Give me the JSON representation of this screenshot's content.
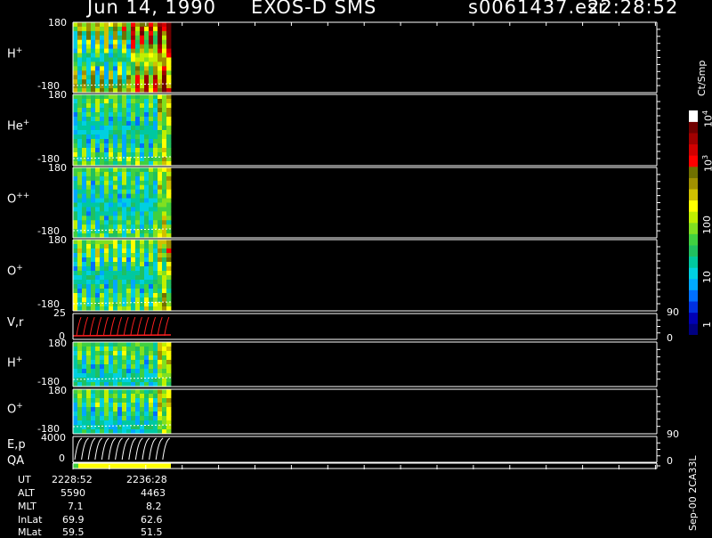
{
  "header": {
    "date": "Jun 14, 1990",
    "instrument": "EXOS-D SMS",
    "file": "s0061437.esr",
    "time": "22:28:52"
  },
  "panels": [
    {
      "id": "h-plus",
      "name": "H",
      "sup": "+",
      "ymax": "180",
      "ymin": "-180"
    },
    {
      "id": "he-plus",
      "name": "He",
      "sup": "+",
      "ymax": "180",
      "ymin": "-180"
    },
    {
      "id": "o-plusplus",
      "name": "O",
      "sup": "++",
      "ymax": "180",
      "ymin": "-180"
    },
    {
      "id": "o-plus",
      "name": "O",
      "sup": "+",
      "ymax": "180",
      "ymin": "-180"
    },
    {
      "id": "vr",
      "name": "V,r",
      "sup": "",
      "ymax": "25",
      "ymin": "0",
      "rmax": "90",
      "rmin": "0"
    },
    {
      "id": "h-plus-2",
      "name": "H",
      "sup": "+",
      "ymax": "180",
      "ymin": "-180"
    },
    {
      "id": "o-plus-2",
      "name": "O",
      "sup": "+",
      "ymax": "180",
      "ymin": "-180"
    },
    {
      "id": "ep",
      "name": "E,p",
      "sup": "",
      "ymax": "4000",
      "ymin": "0",
      "rmax": "90",
      "rmin": "0"
    },
    {
      "id": "qa",
      "name": "QA",
      "sup": ""
    }
  ],
  "colorbar": {
    "unit": "Ct/Smp",
    "ticks": [
      {
        "text": "1",
        "exp": ""
      },
      {
        "text": "10",
        "exp": ""
      },
      {
        "text": "100",
        "exp": ""
      },
      {
        "text": "10",
        "exp": "3"
      },
      {
        "text": "10",
        "exp": "4"
      }
    ],
    "colors": [
      "#000080",
      "#0000b4",
      "#0030e0",
      "#0070ff",
      "#00a8ff",
      "#00d0e0",
      "#00c8a0",
      "#20c060",
      "#40d040",
      "#80e020",
      "#c0f000",
      "#ffff00",
      "#d0c000",
      "#a09000",
      "#707000",
      "#ff0000",
      "#d00000",
      "#a00000",
      "#700000",
      "#ffffff"
    ]
  },
  "footer": {
    "rows": [
      {
        "label": "UT",
        "v1": "2228:52",
        "v2": "2236:28"
      },
      {
        "label": "ALT",
        "v1": "5590",
        "v2": "4463"
      },
      {
        "label": "MLT",
        "v1": "7.1",
        "v2": "8.2"
      },
      {
        "label": "InLat",
        "v1": "69.9",
        "v2": "62.6"
      },
      {
        "label": "MLat",
        "v1": "59.5",
        "v2": "51.5"
      }
    ],
    "stamp": "Sep-00  2CA33L"
  },
  "chart_data": {
    "type": "heatmap",
    "title": "Jun 14, 1990   EXOS-D SMS",
    "x_labels": [
      "2228:52",
      "2236:28"
    ],
    "series": [
      {
        "name": "H+",
        "ylim": [
          -180,
          180
        ]
      },
      {
        "name": "He+",
        "ylim": [
          -180,
          180
        ]
      },
      {
        "name": "O++",
        "ylim": [
          -180,
          180
        ]
      },
      {
        "name": "O+",
        "ylim": [
          -180,
          180
        ]
      },
      {
        "name": "V,r",
        "ylim": [
          0,
          25
        ],
        "right_ylim": [
          0,
          90
        ]
      },
      {
        "name": "H+",
        "ylim": [
          -180,
          180
        ]
      },
      {
        "name": "O+",
        "ylim": [
          -180,
          180
        ]
      },
      {
        "name": "E,p",
        "ylim": [
          0,
          4000
        ],
        "right_ylim": [
          0,
          90
        ]
      },
      {
        "name": "QA"
      }
    ],
    "colorbar": {
      "label": "Ct/Smp",
      "range": [
        1,
        10000
      ],
      "scale": "log"
    }
  }
}
